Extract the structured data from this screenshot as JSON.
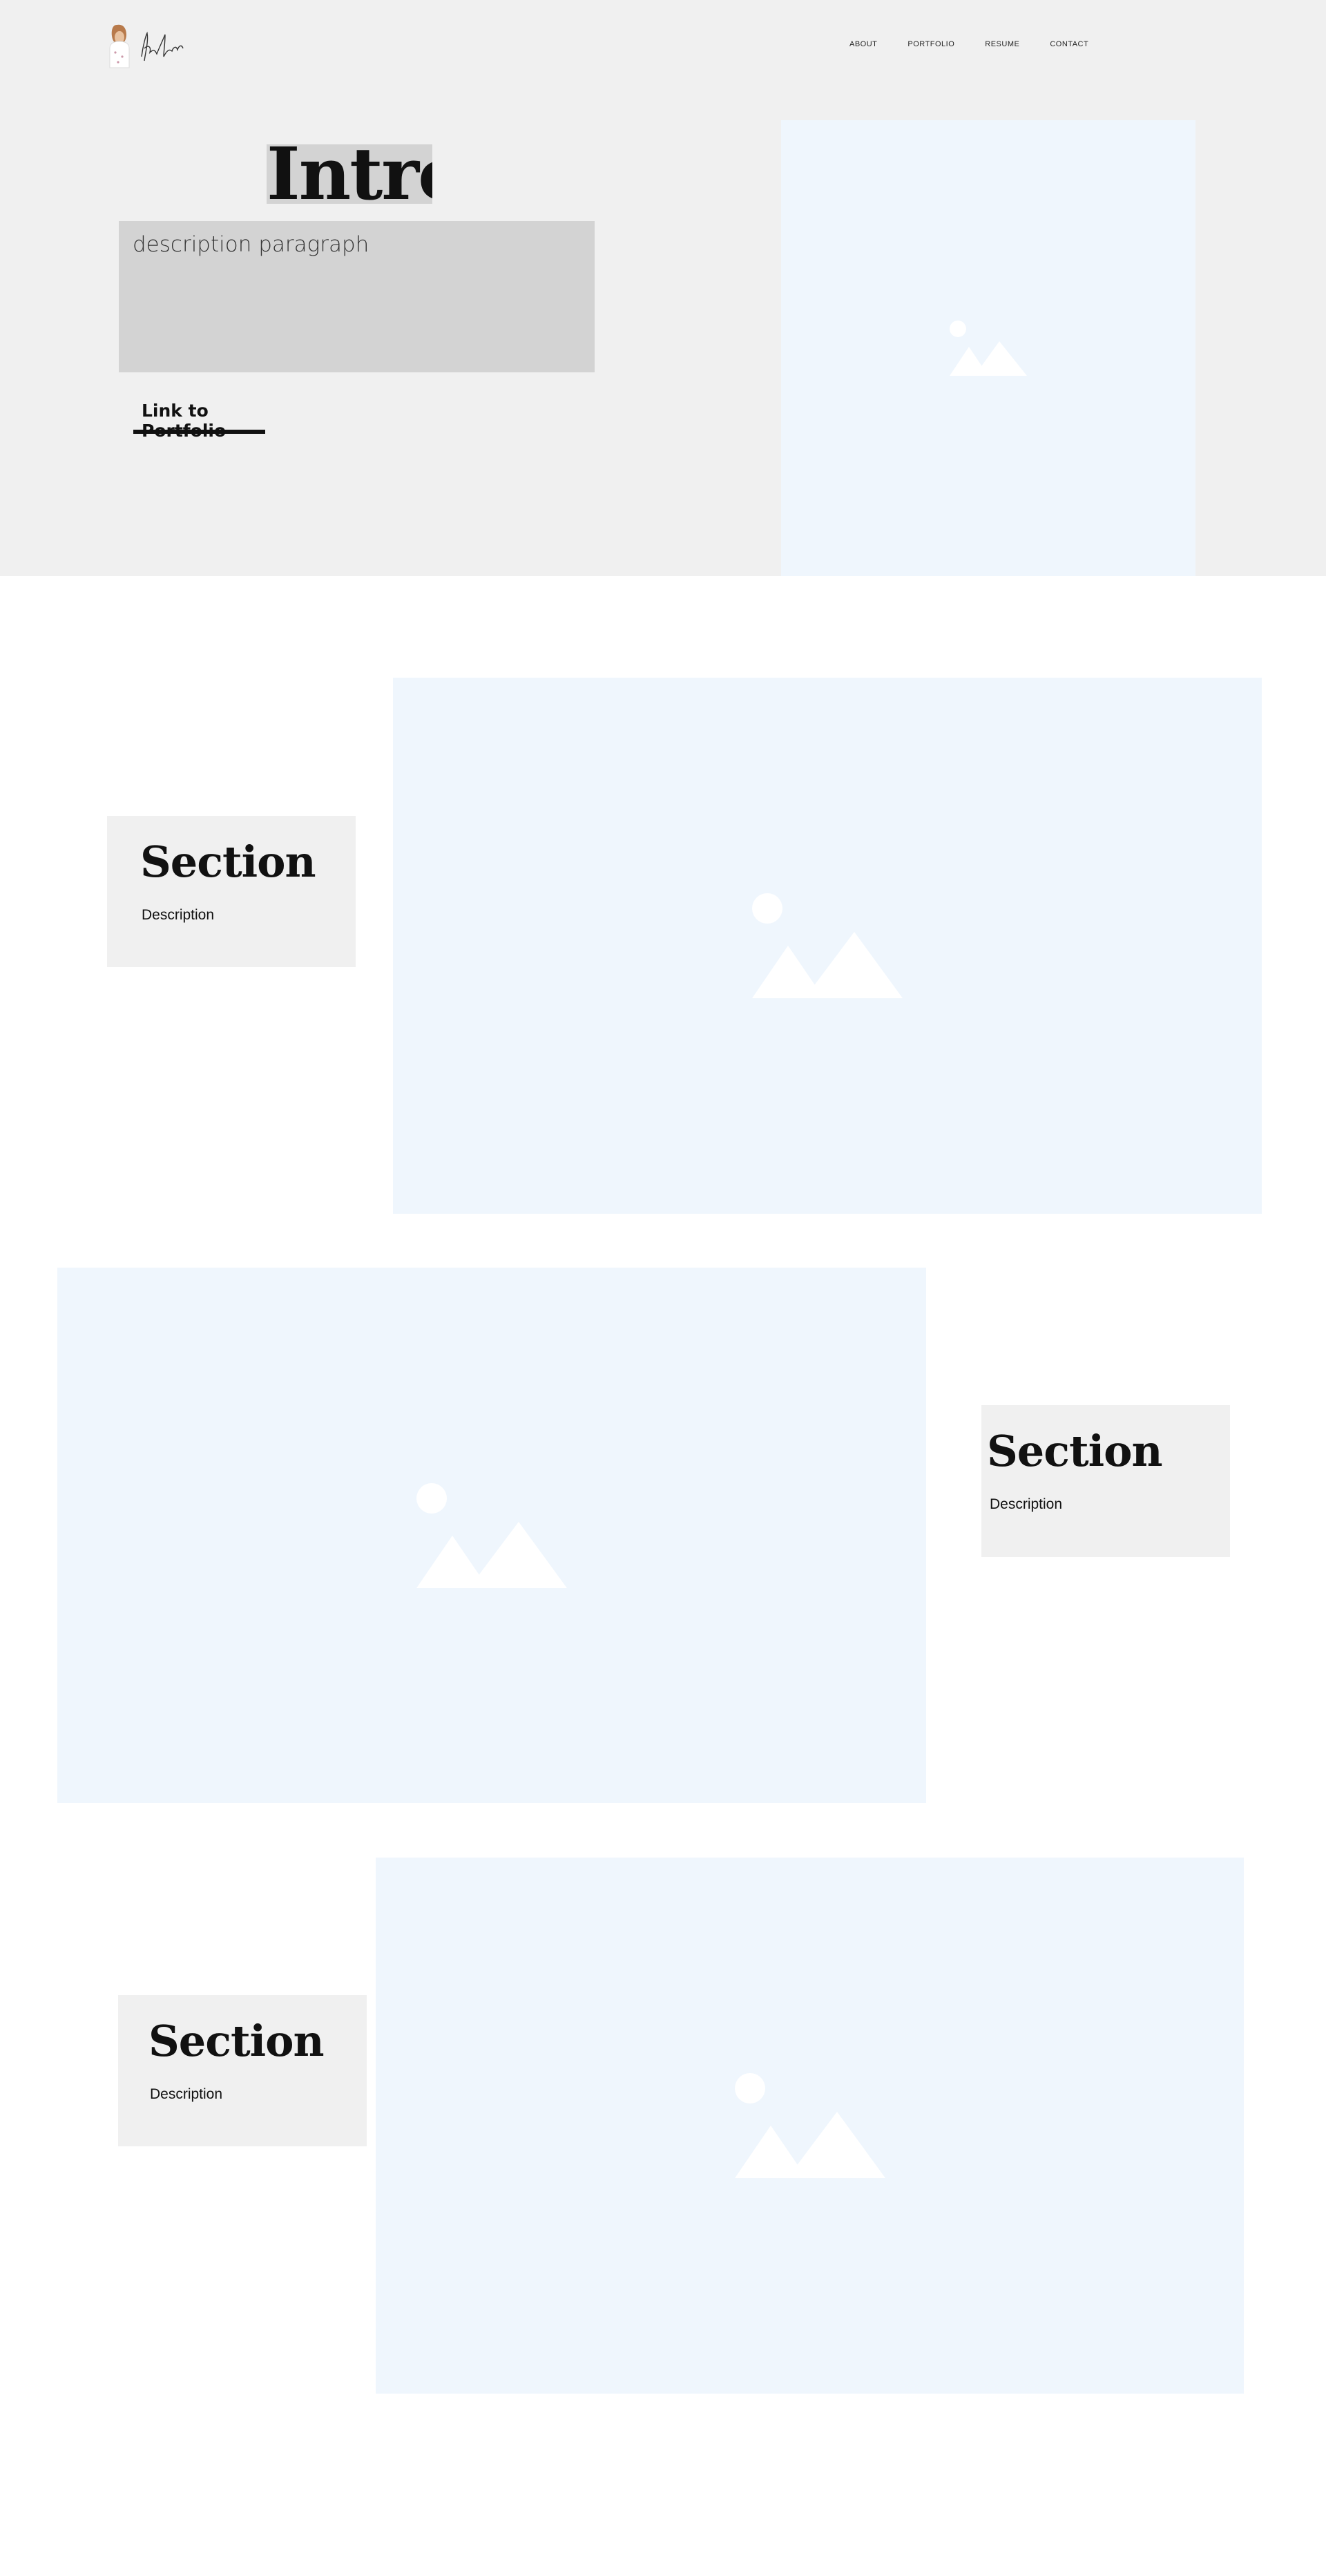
{
  "nav": {
    "items": [
      "ABOUT",
      "PORTFOLIO",
      "RESUME",
      "CONTACT"
    ]
  },
  "intro": {
    "title": "Intro",
    "description": "description paragraph",
    "link_label": "Link to Portfolio"
  },
  "sections": [
    {
      "title": "Section",
      "description": "Description"
    },
    {
      "title": "Section",
      "description": "Description"
    },
    {
      "title": "Section",
      "description": "Description"
    }
  ],
  "colors": {
    "hero_bg": "#f0f0f0",
    "placeholder_bg": "#eff6fd",
    "card_bg": "#f0f0f0",
    "highlight_bg": "#d3d3d3",
    "text": "#111111"
  },
  "icons": [
    "logo-icon",
    "image-placeholder-icon"
  ]
}
